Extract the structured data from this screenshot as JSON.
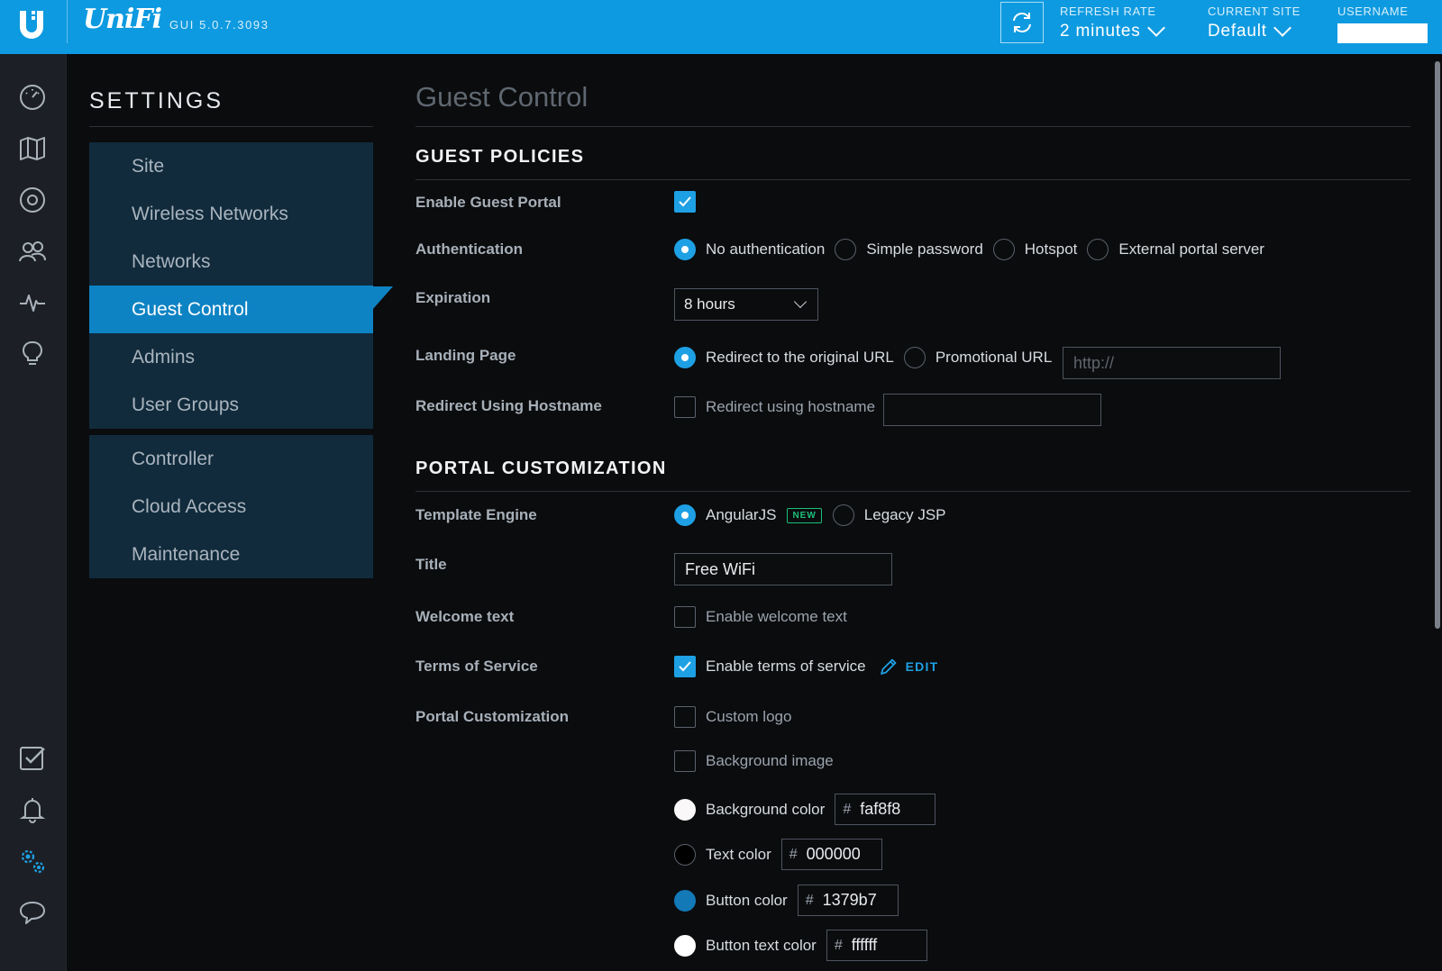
{
  "header": {
    "brand": "UniFi",
    "gui_version": "GUI 5.0.7.3093",
    "refresh_rate": {
      "label": "REFRESH RATE",
      "value": "2 minutes"
    },
    "current_site": {
      "label": "CURRENT SITE",
      "value": "Default"
    },
    "username": {
      "label": "USERNAME"
    }
  },
  "rail": {
    "icons": [
      "dashboard-icon",
      "map-icon",
      "devices-icon",
      "clients-icon",
      "statistics-icon",
      "insights-icon",
      "events-icon",
      "alerts-icon",
      "settings-icon",
      "chat-icon"
    ]
  },
  "settings": {
    "title": "SETTINGS",
    "group1": [
      "Site",
      "Wireless Networks",
      "Networks",
      "Guest Control",
      "Admins",
      "User Groups"
    ],
    "group2": [
      "Controller",
      "Cloud Access",
      "Maintenance"
    ],
    "active": "Guest Control"
  },
  "page": {
    "title": "Guest Control"
  },
  "guest_policies": {
    "heading": "GUEST POLICIES",
    "enable_portal": {
      "label": "Enable Guest Portal",
      "checked": true
    },
    "authentication": {
      "label": "Authentication",
      "options": [
        "No authentication",
        "Simple password",
        "Hotspot",
        "External portal server"
      ],
      "selected": "No authentication"
    },
    "expiration": {
      "label": "Expiration",
      "value": "8 hours"
    },
    "landing_page": {
      "label": "Landing Page",
      "options": [
        "Redirect to the original URL",
        "Promotional URL"
      ],
      "selected": "Redirect to the original URL",
      "url_placeholder": "http://"
    },
    "redirect_hostname": {
      "label": "Redirect Using Hostname",
      "checkbox_label": "Redirect using hostname",
      "checked": false
    }
  },
  "portal_customization": {
    "heading": "PORTAL CUSTOMIZATION",
    "template_engine": {
      "label": "Template Engine",
      "options": [
        "AngularJS",
        "Legacy JSP"
      ],
      "selected": "AngularJS",
      "new_badge": "NEW"
    },
    "title": {
      "label": "Title",
      "value": "Free WiFi"
    },
    "welcome_text": {
      "label": "Welcome text",
      "checkbox_label": "Enable welcome text",
      "checked": false
    },
    "terms": {
      "label": "Terms of Service",
      "checkbox_label": "Enable terms of service",
      "checked": true,
      "edit_label": "EDIT"
    },
    "customization": {
      "label": "Portal Customization",
      "custom_logo": "Custom logo",
      "background_image": "Background image"
    },
    "colors": [
      {
        "label": "Background color",
        "hex": "faf8f8",
        "swatch": "#faf8f8"
      },
      {
        "label": "Text color",
        "hex": "000000",
        "swatch": "#000000"
      },
      {
        "label": "Button color",
        "hex": "1379b7",
        "swatch": "#1379b7"
      },
      {
        "label": "Button text color",
        "hex": "ffffff",
        "swatch": "#ffffff"
      }
    ],
    "hash": "#"
  },
  "theme": {
    "accent": "#1ea0e4",
    "topbar": "#0e9ae0",
    "nav_active": "#0e83c4",
    "new_badge": "#1bbf7a"
  }
}
